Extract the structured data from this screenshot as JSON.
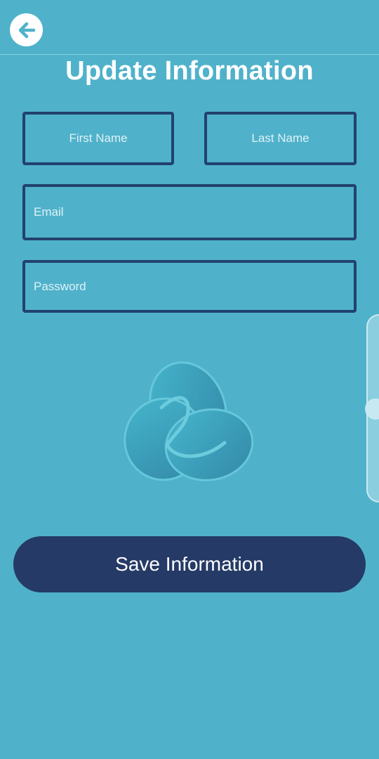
{
  "header": {
    "back_icon": "arrow-left-icon",
    "title": "Update Information"
  },
  "form": {
    "first_name": {
      "placeholder": "First Name",
      "value": ""
    },
    "last_name": {
      "placeholder": "Last Name",
      "value": ""
    },
    "email": {
      "placeholder": "Email",
      "value": ""
    },
    "password": {
      "placeholder": "Password",
      "value": ""
    }
  },
  "logo": {
    "icon": "trefoil-logo-icon"
  },
  "actions": {
    "save_label": "Save Information"
  },
  "colors": {
    "background": "#4fb2ca",
    "field_border": "#22426e",
    "button": "#253a66",
    "text": "#ffffff"
  }
}
